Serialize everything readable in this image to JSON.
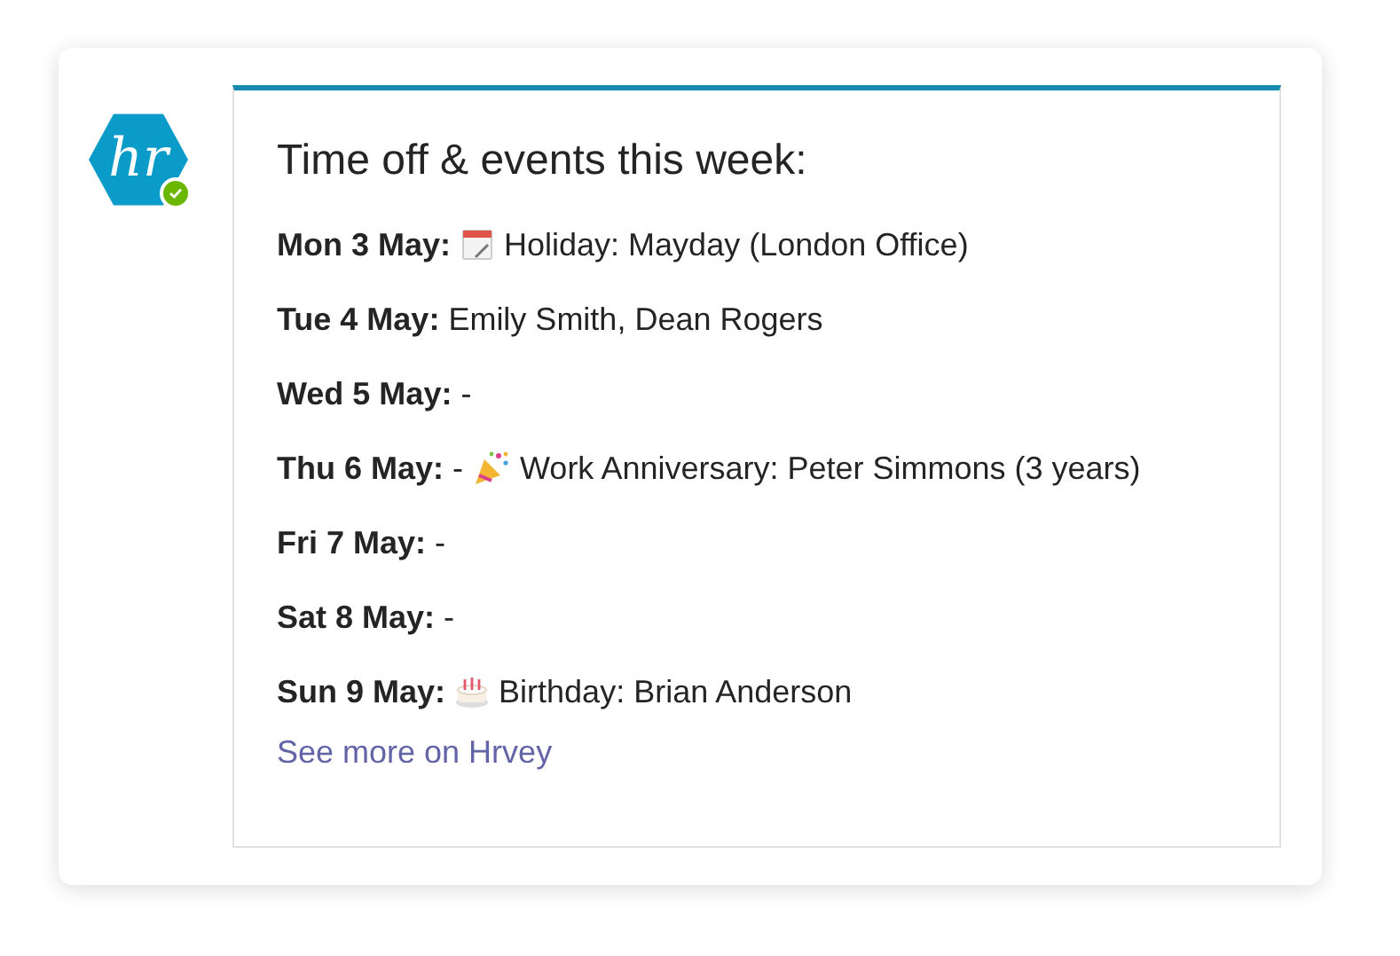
{
  "bot": {
    "logo_text": "hr",
    "online": true
  },
  "card": {
    "title": "Time off & events this week:",
    "rows": [
      {
        "day": "Mon 3 May:",
        "before": "",
        "kind": "calendar",
        "text": "Holiday: Mayday (London Office)"
      },
      {
        "day": "Tue 4 May:",
        "before": "",
        "kind": "plain",
        "text": "Emily Smith, Dean Rogers"
      },
      {
        "day": "Wed 5 May:",
        "before": "",
        "kind": "plain",
        "text": "-"
      },
      {
        "day": "Thu 6 May:",
        "before": "-",
        "kind": "party",
        "text": "Work Anniversary: Peter Simmons (3 years)"
      },
      {
        "day": "Fri 7 May:",
        "before": "",
        "kind": "plain",
        "text": "-"
      },
      {
        "day": "Sat 8 May:",
        "before": "",
        "kind": "plain",
        "text": "-"
      },
      {
        "day": "Sun 9 May:",
        "before": "",
        "kind": "cake",
        "text": "Birthday: Brian Anderson"
      }
    ],
    "link": "See more on Hrvey"
  }
}
